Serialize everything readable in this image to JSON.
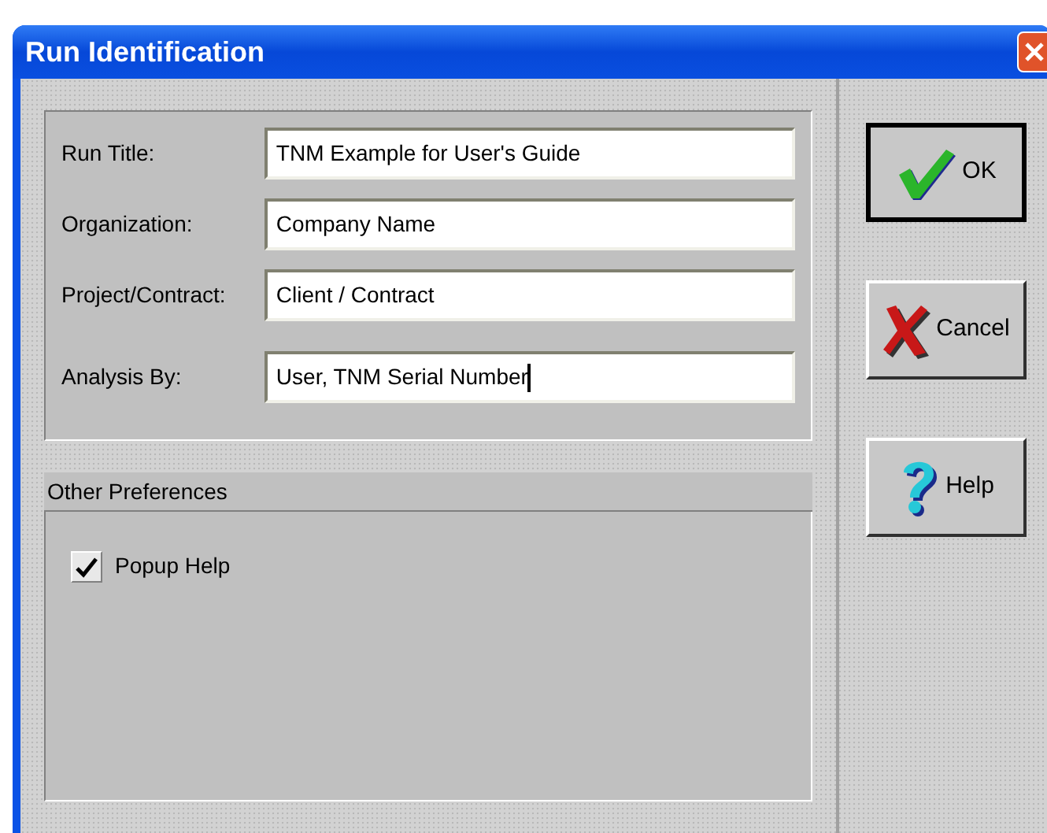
{
  "window": {
    "title": "Run Identification"
  },
  "fields": [
    {
      "label": "Run Title:",
      "value": "TNM Example for User's Guide",
      "focused": false
    },
    {
      "label": "Organization:",
      "value": "Company Name",
      "focused": false
    },
    {
      "label": "Project/Contract:",
      "value": "Client / Contract",
      "focused": false
    },
    {
      "label": "Analysis By:",
      "value": "User, TNM Serial Number",
      "focused": true
    }
  ],
  "preferences": {
    "title": "Other Preferences",
    "options": [
      {
        "label": "Popup Help",
        "checked": true
      }
    ]
  },
  "buttons": [
    {
      "kind": "ok",
      "label": "OK",
      "default": true
    },
    {
      "kind": "cancel",
      "label": "Cancel",
      "default": false
    },
    {
      "kind": "help",
      "label": "Help",
      "default": false
    }
  ]
}
